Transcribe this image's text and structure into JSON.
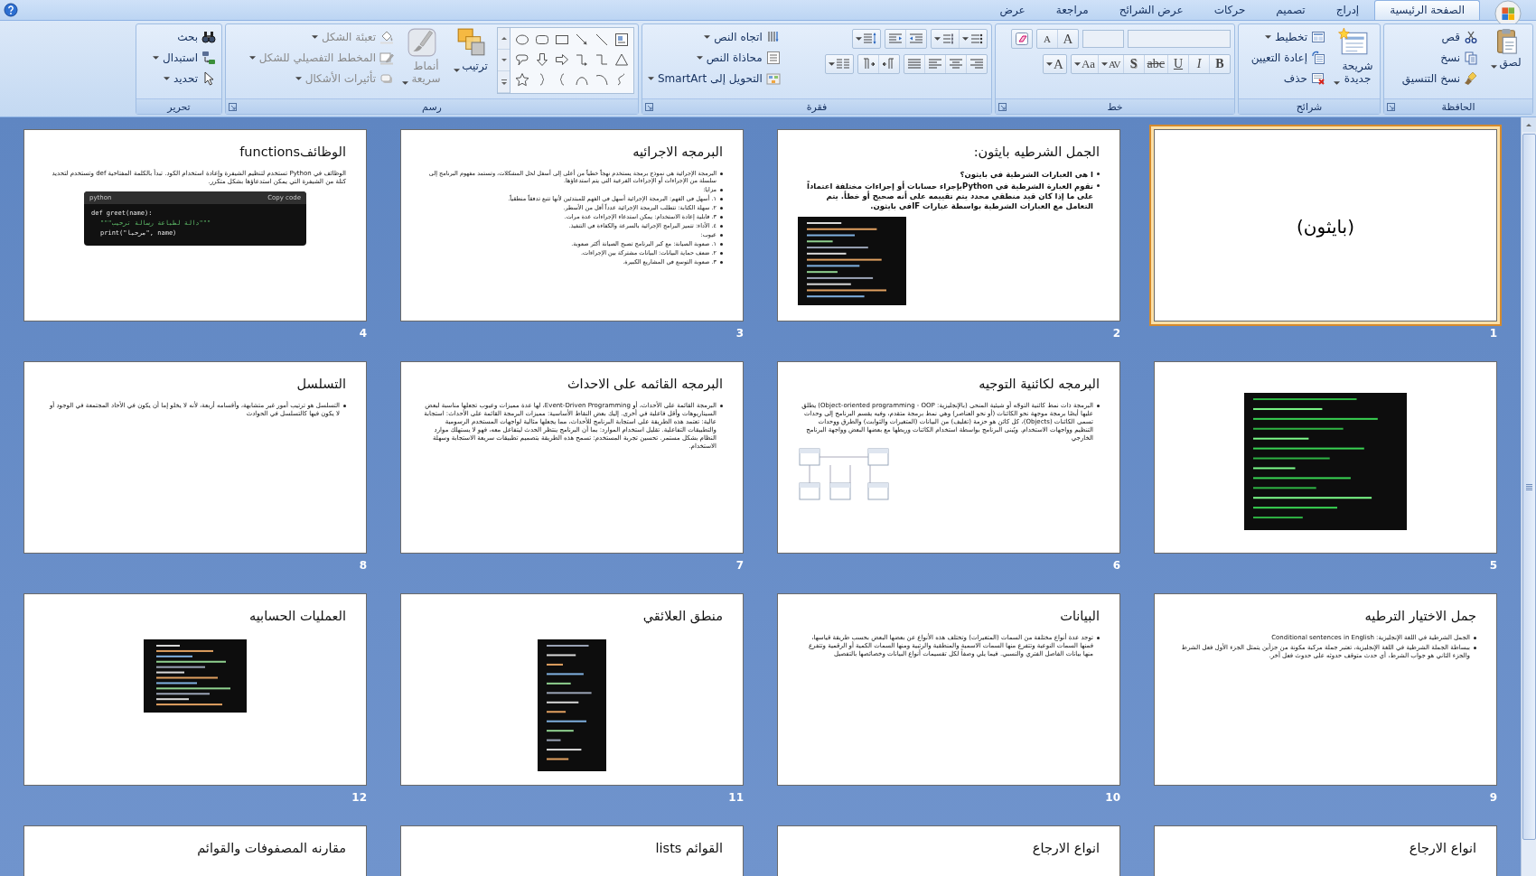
{
  "tabs": [
    {
      "label": "الصفحة الرئيسية",
      "selected": true
    },
    {
      "label": "إدراج",
      "selected": false
    },
    {
      "label": "تصميم",
      "selected": false
    },
    {
      "label": "حركات",
      "selected": false
    },
    {
      "label": "عرض الشرائح",
      "selected": false
    },
    {
      "label": "مراجعة",
      "selected": false
    },
    {
      "label": "عرض",
      "selected": false
    }
  ],
  "ribbon_groups": [
    {
      "title": "الحافظة",
      "kind": "commands",
      "launcher": true,
      "commands": [
        {
          "kind": "large",
          "label": "لصق",
          "menu": true,
          "disabled": false
        },
        {
          "kind": "small",
          "label": "قص",
          "menu": false,
          "disabled": false
        },
        {
          "kind": "small",
          "label": "نسخ",
          "menu": false,
          "disabled": false
        },
        {
          "kind": "small",
          "label": "نسخ التنسيق",
          "menu": false,
          "disabled": false
        }
      ]
    },
    {
      "title": "شرائح",
      "kind": "commands",
      "launcher": false,
      "commands": [
        {
          "kind": "large",
          "label": "شريحة جديدة",
          "menu": true,
          "disabled": false
        },
        {
          "kind": "small",
          "label": "تخطيط",
          "menu": true,
          "disabled": false
        },
        {
          "kind": "small",
          "label": "إعادة التعيين",
          "menu": false,
          "disabled": false
        },
        {
          "kind": "small",
          "label": "حذف",
          "menu": false,
          "disabled": false
        }
      ]
    },
    {
      "title": "خط",
      "kind": "font",
      "launcher": true,
      "size_buttons": [
        "A",
        "A"
      ],
      "format_buttons": [
        {
          "label": "B",
          "menu": false
        },
        {
          "label": "I",
          "menu": false
        },
        {
          "label": "U",
          "menu": false
        },
        {
          "label": "abc",
          "menu": false
        },
        {
          "label": "S",
          "menu": false
        },
        {
          "label": "AV",
          "menu": true
        },
        {
          "label": "Aa",
          "menu": true
        },
        {
          "label": "A",
          "menu": true
        }
      ]
    },
    {
      "title": "فقرة",
      "kind": "paragraph",
      "launcher": true,
      "commands": [
        {
          "kind": "small",
          "label": "اتجاه النص",
          "menu": true,
          "disabled": false
        },
        {
          "kind": "small",
          "label": "محاذاة النص",
          "menu": true,
          "disabled": false
        },
        {
          "kind": "small",
          "label": "التحويل إلى SmartArt",
          "menu": true,
          "disabled": false
        }
      ]
    },
    {
      "title": "رسم",
      "kind": "commands",
      "launcher": true,
      "commands": [
        {
          "kind": "gallery",
          "disabled": false
        },
        {
          "kind": "large",
          "label": "ترتيب",
          "menu": true,
          "disabled": false
        },
        {
          "kind": "large",
          "label": "أنماط سريعة",
          "menu": true,
          "disabled": true
        },
        {
          "kind": "small",
          "label": "تعبئة الشكل",
          "menu": true,
          "disabled": true
        },
        {
          "kind": "small",
          "label": "المخطط التفصيلي للشكل",
          "menu": true,
          "disabled": true
        },
        {
          "kind": "small",
          "label": "تأثيرات الأشكال",
          "menu": true,
          "disabled": true
        }
      ]
    },
    {
      "title": "تحرير",
      "kind": "commands",
      "launcher": false,
      "commands": [
        {
          "kind": "small",
          "label": "بحث",
          "menu": false,
          "disabled": false
        },
        {
          "kind": "small",
          "label": "استبدال",
          "menu": true,
          "disabled": false
        },
        {
          "kind": "small",
          "label": "تحديد",
          "menu": true,
          "disabled": false
        }
      ]
    }
  ],
  "slides": [
    {
      "number": "1",
      "selected": true,
      "kind": "title",
      "title": "(بايثون)"
    },
    {
      "number": "2",
      "selected": false,
      "kind": "content",
      "title": "الجمل الشرطيه بايثون:",
      "bullets": [
        "ا هي العبارات الشرطية في بايثون؟",
        "تقوم العبارة الشرطية في Pythonبإجراء حسابات أو إجراءات مختلفة اعتماداً على ما إذا كان قيد منطقي محدد يتم تقييمه على أنه صحيح أو خطأ. يتم التعامل مع العبارات الشرطية بواسطة عبارات IFفي بايثون."
      ],
      "media": {
        "kind": "code"
      }
    },
    {
      "number": "3",
      "selected": false,
      "kind": "content",
      "title": "البرمجه الاجرائيه",
      "bullets": [
        "البرمجة الإجرائية هي نموذج برمجة يستخدم نهجاً خطياً من أعلى إلى أسفل لحل المشكلات، وتستمد مفهوم البرنامج إلى سلسلة من الإجراءات أو الإجراءات الفرعية التي يتم استدعاؤها.",
        "مزايا:",
        "١. أسهل في الفهم: البرمجة الإجرائية أسهل في الفهم للمبتدئين لأنها تتبع تدفقاً منطقياً.",
        "٢. سهلة الكتابة: تتطلب البرمجة الإجرائية عدداً أقل من الأسطر.",
        "٣. قابلية إعادة الاستخدام: يمكن استدعاء الإجراءات عدة مرات.",
        "٤. الأداء: تتميز البرامج الإجرائية بالسرعة والكفاءة في التنفيذ.",
        "عيوب:",
        "١. صعوبة الصيانة: مع كبر البرنامج تصبح الصيانة أكثر صعوبة.",
        "٢. ضعف حماية البيانات: البيانات مشتركة بين الإجراءات.",
        "٣. صعوبة التوسع في المشاريع الكبيرة."
      ]
    },
    {
      "number": "4",
      "selected": false,
      "kind": "content",
      "title": "الوظائفfunctions",
      "paragraphs": [
        "الوظائف في Python تستخدم لتنظيم الشيفرة وإعادة استخدام الكود. تبدأ بالكلمة المفتاحية def وتستخدم لتحديد كتلة من الشيفرة التي يمكن استدعاؤها بشكل متكرر."
      ],
      "media": {
        "kind": "code-block",
        "language": "python",
        "copy": "Copy code",
        "lines": [
          "def greet(name):",
          "\"\"\"دالة لطباعة رسالة ترحيب\"\"\"",
          "print(\"مرحبا\", name)"
        ]
      }
    },
    {
      "number": "5",
      "selected": false,
      "kind": "content",
      "media": {
        "kind": "terminal"
      }
    },
    {
      "number": "6",
      "selected": false,
      "kind": "content",
      "title": "البرمجه لكائنية التوجيه",
      "bullets": [
        "البرمجة ذات نمط كائنية التوجّه أو شيئية المنحى (بالإنجليزية: Object-oriented programming - OOP) يطلق عليها أيضًا برمجة موجهة نحو الكائنات (أو نحو العناصر) وهي نمط برمجة متقدم، وفيه يقسم البرنامج إلى وحدات تسمى الكائنات (Objects)، كل كائن هو حزمة (تغليف) من البيانات (المتغيرات والثوابت) والطرق ووحدات التنظيم وواجهات الاستخدام. ويُبنى البرنامج بواسطة استخدام الكائنات وربطها مع بعضها البعض وواجهة البرنامج الخارجي"
      ],
      "media": {
        "kind": "diagram"
      }
    },
    {
      "number": "7",
      "selected": false,
      "kind": "content",
      "title": "البرمجه القائمه على الاحداث",
      "bullets": [
        "البرمجة القائمة على الأحداث، أو Event-Driven Programming، لها عدة مميزات وعيوب تجعلها مناسبة لبعض السيناريوهات وأقل فاعلية في أخرى. إليك بعض النقاط الأساسية: مميزات البرمجة القائمة على الأحداث: استجابة عالية: تعتمد هذه الطريقة على استجابة البرنامج للأحداث، مما يجعلها مثالية لواجهات المستخدم الرسومية والتطبيقات التفاعلية. تقليل استخدام الموارد: بما أن البرنامج ينتظر الحدث ليتفاعل معه، فهو لا يستهلك موارد النظام بشكل مستمر. تحسين تجربة المستخدم: تسمح هذه الطريقة بتصميم تطبيقات سريعة الاستجابة وسهلة الاستخدام."
      ]
    },
    {
      "number": "8",
      "selected": false,
      "kind": "content",
      "title": "التسلسل",
      "bullets": [
        "التسلسل هو ترتيب أمور غير متشابهة، وأقسامه أربعة، لأنه لا يخلو إما أن يكون في الأحاد المجتمعة في الوجود أو لا يكون فيها كالتسلسل في الحوادث"
      ]
    },
    {
      "number": "9",
      "selected": false,
      "kind": "content",
      "title": "جمل الاختيار الترطيه",
      "bullets": [
        "الجمل الشرطية في اللغة الإنجليزية: Conditional sentences in English",
        "ببساطة الجملة الشرطية في اللغة الإنجليزية، تعتبر جملة مركبة مكونة من جزأين يتمثل الجزء الأول فعل الشرط والجزء الثاني هو جواب الشرط، أي حدث متوقف حدوثه على حدوث فعل آخر."
      ]
    },
    {
      "number": "10",
      "selected": false,
      "kind": "content",
      "title": "البيانات",
      "bullets": [
        "توجد عدة أنواع مختلفة من السمات (المتغيرات) وتختلف هذه الأنواع عن بعضها البعض بحسب طريقة قياسها، فمنها السمات النوعية وتتفرع منها السمات الاسمية والمنطقية والرتبية ومنها السمات الكمية أو الرقمية وتتفرع منها بيانات الفاصل الفتري والنسبي. فيما يلي وصفاً لكل تقسيمات أنواع البيانات وخصائصها بالتفصيل"
      ]
    },
    {
      "number": "11",
      "selected": false,
      "kind": "content",
      "title": "منطق العلائقي",
      "media": {
        "kind": "code"
      }
    },
    {
      "number": "12",
      "selected": false,
      "kind": "content",
      "title": "العمليات الحسابيه",
      "media": {
        "kind": "code"
      }
    },
    {
      "selected": false,
      "kind": "content",
      "title": "انواع الارجاع"
    },
    {
      "selected": false,
      "kind": "content",
      "title": "انواع الارجاع"
    },
    {
      "selected": false,
      "kind": "content",
      "title": "القوائم lists"
    },
    {
      "selected": false,
      "kind": "content",
      "title": "مقارنه المصفوفات والقوائم"
    }
  ]
}
